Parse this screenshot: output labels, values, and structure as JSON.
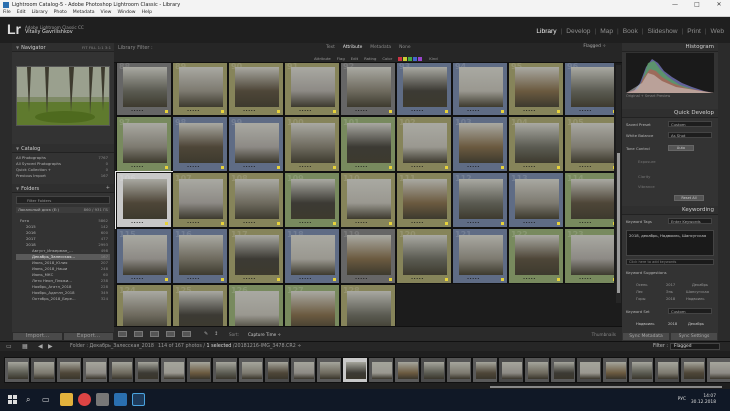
{
  "window": {
    "title": "Lightroom Catalog-5 - Adobe Photoshop Lightroom Classic - Library",
    "controls": [
      "—",
      "□",
      "✕"
    ]
  },
  "menu": [
    "File",
    "Edit",
    "Library",
    "Photo",
    "Metadata",
    "View",
    "Window",
    "Help"
  ],
  "identity": {
    "logo": "Lr",
    "product": "Adobe Lightroom Classic CC",
    "user": "Vitaliy Gavrilishkov",
    "modules": [
      "Library",
      "Develop",
      "Map",
      "Book",
      "Slideshow",
      "Print",
      "Web"
    ],
    "active_module": "Library"
  },
  "left": {
    "navigator": {
      "title": "Navigator",
      "options": "FIT  FILL  1:1  3:1"
    },
    "catalog": {
      "title": "Catalog",
      "items": [
        {
          "label": "All Photographs",
          "count": "7767"
        },
        {
          "label": "All Synced Photographs",
          "count": "0"
        },
        {
          "label": "Quick Collection +",
          "count": "0"
        },
        {
          "label": "Previous Import",
          "count": "167"
        }
      ]
    },
    "folders": {
      "title": "Folders",
      "filter_placeholder": "Filter Folders",
      "volume": {
        "label": "Локальный диск (E:)",
        "count": "860 / 931 ГБ"
      },
      "items": [
        {
          "label": "Fото",
          "count": "5862"
        },
        {
          "label": "2015",
          "count": "142"
        },
        {
          "label": "2016",
          "count": "600"
        },
        {
          "label": "2017",
          "count": "477"
        },
        {
          "label": "2018",
          "count": "2993"
        },
        {
          "label": "Август_Инкерман_...",
          "count": "498"
        },
        {
          "label": "Декабрь_Залесская...",
          "count": "167"
        },
        {
          "label": "Июль_2018_Юлия",
          "count": "207"
        },
        {
          "label": "Июнь_2018_Наши",
          "count": "248"
        },
        {
          "label": "Июнь_МКС",
          "count": "60"
        },
        {
          "label": "Лето Неон_Пляжи...",
          "count": "238"
        },
        {
          "label": "Ноябрь_Агатл_2018",
          "count": "228"
        },
        {
          "label": "Ноябрь_Адатлн_2018",
          "count": "349"
        },
        {
          "label": "Октябрь_2018_Бере...",
          "count": "324"
        }
      ],
      "selected_index": 6
    },
    "import_label": "Import...",
    "export_label": "Export..."
  },
  "center": {
    "filter_title": "Library Filter :",
    "tabs": [
      "Text",
      "Attribute",
      "Metadata",
      "None"
    ],
    "active_tab": "Attribute",
    "preset": "Flagged ÷",
    "attribute_row": [
      "Attribute",
      "Flag",
      "Edit",
      "Rating",
      "Color",
      "Kind"
    ],
    "cell_numbers": [
      "88",
      "89",
      "90",
      "91",
      "92",
      "93",
      "94",
      "95",
      "96",
      "97",
      "98",
      "99",
      "100",
      "101",
      "102",
      "103",
      "104",
      "105",
      "106",
      "107",
      "108",
      "109",
      "110",
      "111",
      "112",
      "113",
      "114",
      "115",
      "116",
      "117",
      "118",
      "119",
      "120",
      "121",
      "122",
      "123",
      "124",
      "125",
      "126",
      "127",
      "128",
      "129",
      "130",
      "131",
      "132",
      "133",
      "134"
    ],
    "sort_label": "Sort:",
    "sort_value": "Capture Time ÷",
    "thumbnails_label": "Thumbnails"
  },
  "right": {
    "histogram": {
      "title": "Histogram",
      "info": "Original + Smart Preview"
    },
    "quick_develop": {
      "title": "Quick Develop",
      "saved_preset": {
        "label": "Saved Preset",
        "value": "Custom"
      },
      "white_balance": {
        "label": "White Balance",
        "value": "As Shot"
      },
      "tone_control": {
        "label": "Tone Control",
        "button": "Auto"
      },
      "sliders": [
        "Exposure",
        "Clarity",
        "Vibrance"
      ],
      "reset": "Reset All"
    },
    "keywording": {
      "title": "Keywording",
      "tags_label": "Keyword Tags",
      "tags_mode": "Enter Keywords",
      "keywords": "2018, декабрь, Надвоиль, Шапсугская",
      "input_placeholder": "Click here to add keywords",
      "suggestions_title": "Keyword Suggestions",
      "suggestions": [
        "Осень",
        "2017",
        "Декабрь",
        "Лес",
        "Эль",
        "Шапсугская",
        "Горы",
        "2018",
        "Надвоиль"
      ],
      "set_label": "Keyword Set",
      "set_value": "Custom",
      "set_items": [
        "Надвоиль",
        "2018",
        "Декабрь"
      ]
    },
    "sync_metadata": "Sync Metadata",
    "sync_settings": "Sync Settings"
  },
  "filmstrip": {
    "folder": "Folder : Декабрь_Залесская_2018",
    "info_prefix": "114 of 167 photos /",
    "info_selected": "1 selected",
    "info_file": "/20181216-IMG_3478.CR2 ÷",
    "filter_label": "Filter :",
    "filter_value": "Flagged"
  },
  "taskbar": {
    "lang": "РУС",
    "time": "14:07",
    "date": "30.12.2018"
  },
  "colors": {
    "cell_gray": "#666666",
    "cell_green": "#788a5e",
    "cell_blue": "#5f6c85",
    "cell_olive": "#86845a",
    "selected_cell": "#c8c8c8",
    "taskbar": "#101826"
  }
}
